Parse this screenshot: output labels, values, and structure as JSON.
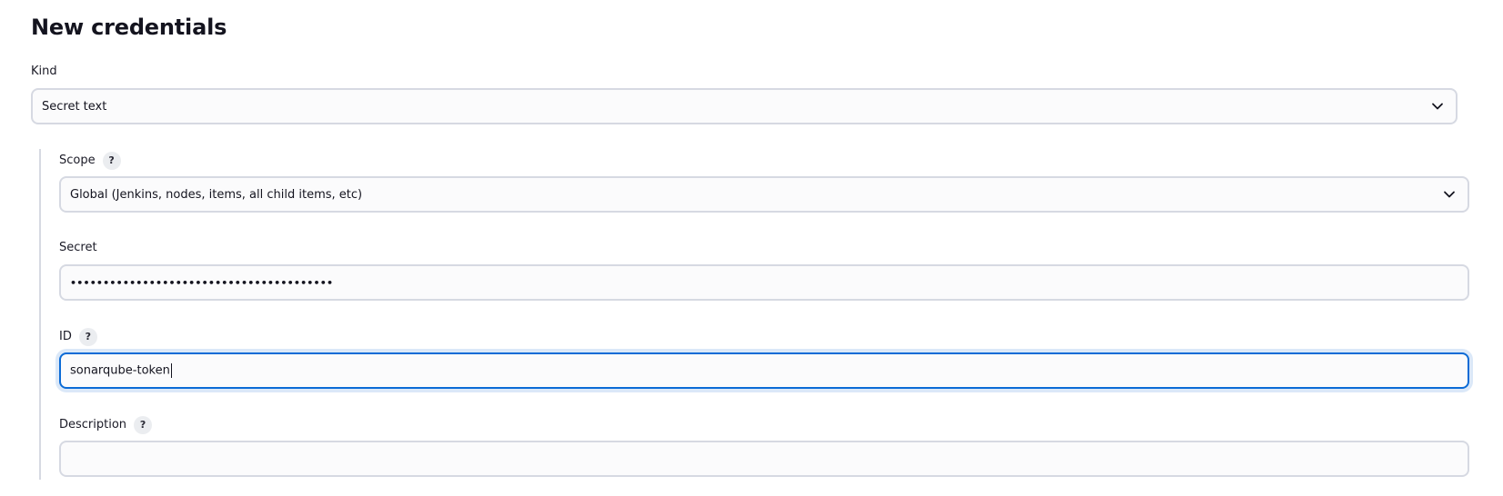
{
  "page": {
    "title": "New credentials"
  },
  "kind": {
    "label": "Kind",
    "selected": "Secret text"
  },
  "scope": {
    "label": "Scope",
    "help": "?",
    "selected": "Global (Jenkins, nodes, items, all child items, etc)"
  },
  "secret": {
    "label": "Secret",
    "value_masked": "••••••••••••••••••••••••••••••••••••••••"
  },
  "id": {
    "label": "ID",
    "help": "?",
    "value": "sonarqube-token"
  },
  "description": {
    "label": "Description",
    "help": "?",
    "value": ""
  },
  "colors": {
    "focus": "#0b6bd6",
    "border": "#d6d9e2",
    "field_bg": "#fbfbfc"
  },
  "icons": {
    "select_indicator": "chevron-down-icon",
    "help": "help-icon"
  }
}
